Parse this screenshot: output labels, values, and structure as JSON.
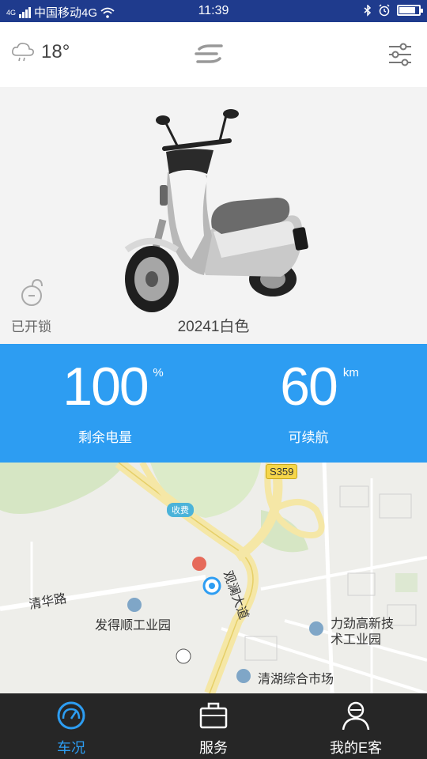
{
  "status_bar": {
    "network_badge": "4G",
    "carrier": "中国移动4G",
    "time": "11:39",
    "battery_level": 0.85,
    "icons": [
      "signal-icon",
      "wifi-icon",
      "bluetooth-icon",
      "alarm-icon",
      "battery-icon"
    ]
  },
  "header": {
    "weather_icon": "cloud-rain-icon",
    "temperature": "18°",
    "logo_icon": "brand-logo-icon",
    "settings_icon": "sliders-icon"
  },
  "vehicle": {
    "lock_status": "已开锁",
    "model_name": "20241白色"
  },
  "stats": {
    "battery": {
      "value": "100",
      "unit": "%",
      "label": "剩余电量"
    },
    "range": {
      "value": "60",
      "unit": "km",
      "label": "可续航"
    }
  },
  "map": {
    "labels": {
      "road_shield": "S359",
      "toll": "收费",
      "road_qinghua": "清华路",
      "road_guanlan": "观澜大道",
      "park_fadeshun": "发得顺工业园",
      "park_lijingao_1": "力劲高新技",
      "park_lijingao_2": "术工业园",
      "market": "清湖综合市场"
    }
  },
  "tabbar": {
    "tabs": [
      {
        "label": "车况",
        "icon": "speedometer-icon",
        "active": true
      },
      {
        "label": "服务",
        "icon": "briefcase-icon",
        "active": false
      },
      {
        "label": "我的E客",
        "icon": "user-icon",
        "active": false
      }
    ]
  },
  "colors": {
    "status_bar": "#1f3b8d",
    "accent": "#2d9df2",
    "tabbar": "#262626"
  }
}
